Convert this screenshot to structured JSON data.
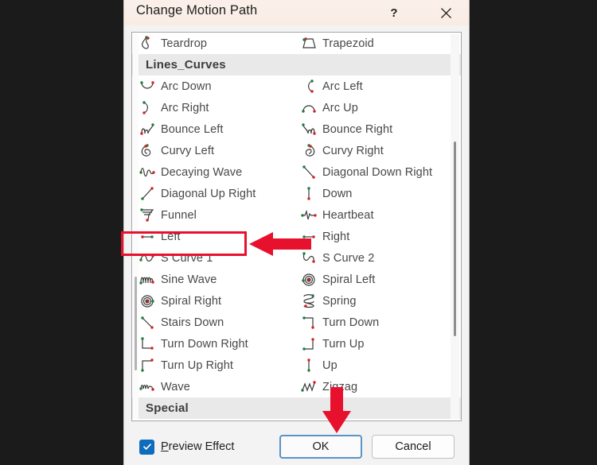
{
  "dialog": {
    "title": "Change Motion Path",
    "help_icon": "?",
    "help_icon_name": "help-icon",
    "close_icon": "close-icon",
    "accent_blue": "#0f6cbd",
    "annotation_red": "#e8112d",
    "titlebar_bg": "#faefe8",
    "group_header_bg": "#e9e9e9"
  },
  "list": {
    "groups": [
      {
        "header": null,
        "rows": [
          {
            "left": {
              "label": "Teardrop",
              "icon": "teardrop-path-icon"
            },
            "right": {
              "label": "Trapezoid",
              "icon": "trapezoid-path-icon"
            }
          }
        ]
      },
      {
        "header": "Lines_Curves",
        "rows": [
          {
            "left": {
              "label": "Arc Down",
              "icon": "arc-down-path-icon"
            },
            "right": {
              "label": "Arc Left",
              "icon": "arc-left-path-icon"
            }
          },
          {
            "left": {
              "label": "Arc Right",
              "icon": "arc-right-path-icon"
            },
            "right": {
              "label": "Arc Up",
              "icon": "arc-up-path-icon"
            }
          },
          {
            "left": {
              "label": "Bounce Left",
              "icon": "bounce-left-path-icon"
            },
            "right": {
              "label": "Bounce Right",
              "icon": "bounce-right-path-icon"
            }
          },
          {
            "left": {
              "label": "Curvy Left",
              "icon": "curvy-left-path-icon"
            },
            "right": {
              "label": "Curvy Right",
              "icon": "curvy-right-path-icon"
            }
          },
          {
            "left": {
              "label": "Decaying Wave",
              "icon": "decaying-wave-path-icon"
            },
            "right": {
              "label": "Diagonal Down Right",
              "icon": "diagonal-down-right-path-icon"
            }
          },
          {
            "left": {
              "label": "Diagonal Up Right",
              "icon": "diagonal-up-right-path-icon"
            },
            "right": {
              "label": "Down",
              "icon": "down-path-icon"
            }
          },
          {
            "left": {
              "label": "Funnel",
              "icon": "funnel-path-icon"
            },
            "right": {
              "label": "Heartbeat",
              "icon": "heartbeat-path-icon"
            }
          },
          {
            "left": {
              "label": "Left",
              "icon": "left-path-icon",
              "highlighted": true
            },
            "right": {
              "label": "Right",
              "icon": "right-path-icon"
            }
          },
          {
            "left": {
              "label": "S Curve 1",
              "icon": "s-curve-1-path-icon"
            },
            "right": {
              "label": "S Curve 2",
              "icon": "s-curve-2-path-icon"
            }
          },
          {
            "left": {
              "label": "Sine Wave",
              "icon": "sine-wave-path-icon"
            },
            "right": {
              "label": "Spiral Left",
              "icon": "spiral-left-path-icon"
            }
          },
          {
            "left": {
              "label": "Spiral Right",
              "icon": "spiral-right-path-icon"
            },
            "right": {
              "label": "Spring",
              "icon": "spring-path-icon"
            }
          },
          {
            "left": {
              "label": "Stairs Down",
              "icon": "stairs-down-path-icon"
            },
            "right": {
              "label": "Turn Down",
              "icon": "turn-down-path-icon"
            }
          },
          {
            "left": {
              "label": "Turn Down Right",
              "icon": "turn-down-right-path-icon"
            },
            "right": {
              "label": "Turn Up",
              "icon": "turn-up-path-icon"
            }
          },
          {
            "left": {
              "label": "Turn Up Right",
              "icon": "turn-up-right-path-icon"
            },
            "right": {
              "label": "Up",
              "icon": "up-path-icon"
            }
          },
          {
            "left": {
              "label": "Wave",
              "icon": "wave-path-icon"
            },
            "right": {
              "label": "Zigzag",
              "icon": "zigzag-path-icon"
            }
          }
        ]
      },
      {
        "header": "Special",
        "rows": []
      }
    ]
  },
  "footer": {
    "preview_label_prefix": "P",
    "preview_label_rest": "review Effect",
    "preview_checked": true,
    "ok_label": "OK",
    "cancel_label": "Cancel"
  },
  "annotations": {
    "highlight_target": "Left",
    "arrow_left_points_to": "Left",
    "arrow_down_points_to": "OK"
  }
}
